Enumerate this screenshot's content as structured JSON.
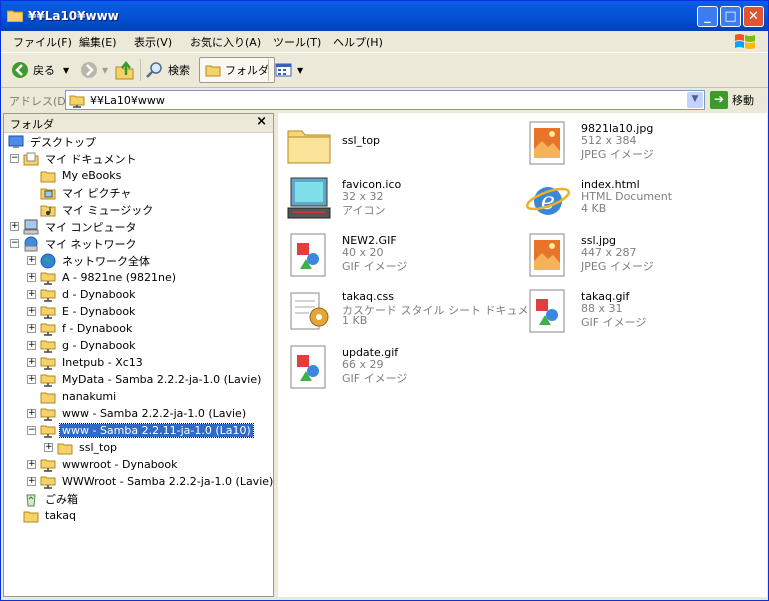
{
  "window": {
    "title": "¥¥La10¥www"
  },
  "menu": [
    "ファイル(F)",
    "編集(E)",
    "表示(V)",
    "お気に入り(A)",
    "ツール(T)",
    "ヘルプ(H)"
  ],
  "toolbar": {
    "back": "戻る",
    "search": "検索",
    "folders": "フォルダ"
  },
  "address": {
    "label": "アドレス(D)",
    "value": "¥¥La10¥www",
    "go": "移動"
  },
  "folder_pane": {
    "title": "フォルダ",
    "close": "×",
    "tree": [
      {
        "label": "デスクトップ",
        "exp": "",
        "icon": "desktop"
      },
      {
        "label": "マイ ドキュメント",
        "exp": "−",
        "icon": "mydocs"
      },
      {
        "label": "My eBooks",
        "exp": "",
        "icon": "folder"
      },
      {
        "label": "マイ ピクチャ",
        "exp": "",
        "icon": "pictures"
      },
      {
        "label": "マイ ミュージック",
        "exp": "",
        "icon": "music"
      },
      {
        "label": "マイ コンピュータ",
        "exp": "+",
        "icon": "computer"
      },
      {
        "label": "マイ ネットワーク",
        "exp": "−",
        "icon": "network"
      },
      {
        "label": "ネットワーク全体",
        "exp": "+",
        "icon": "globe"
      },
      {
        "label": "A - 9821ne (9821ne)",
        "exp": "+",
        "icon": "share"
      },
      {
        "label": "d - Dynabook",
        "exp": "+",
        "icon": "share"
      },
      {
        "label": "E - Dynabook",
        "exp": "+",
        "icon": "share"
      },
      {
        "label": "f - Dynabook",
        "exp": "+",
        "icon": "share"
      },
      {
        "label": "g - Dynabook",
        "exp": "+",
        "icon": "share"
      },
      {
        "label": "Inetpub - Xc13",
        "exp": "+",
        "icon": "share"
      },
      {
        "label": "MyData - Samba 2.2.2-ja-1.0 (Lavie)",
        "exp": "+",
        "icon": "share"
      },
      {
        "label": "nanakumi",
        "exp": "",
        "icon": "folder"
      },
      {
        "label": "www - Samba 2.2.2-ja-1.0 (Lavie)",
        "exp": "+",
        "icon": "share"
      },
      {
        "label": "www - Samba 2.2.11-ja-1.0 (La10)",
        "exp": "−",
        "icon": "share",
        "selected": true
      },
      {
        "label": "ssl_top",
        "exp": "+",
        "icon": "folder"
      },
      {
        "label": "wwwroot - Dynabook",
        "exp": "+",
        "icon": "share"
      },
      {
        "label": "WWWroot - Samba 2.2.2-ja-1.0 (Lavie)",
        "exp": "+",
        "icon": "share"
      },
      {
        "label": "ごみ箱",
        "exp": "",
        "icon": "recycle"
      },
      {
        "label": "takaq",
        "exp": "",
        "icon": "folder"
      }
    ]
  },
  "files": [
    {
      "name": "ssl_top",
      "line2": "",
      "line3": "",
      "icon": "folder"
    },
    {
      "name": "9821la10.jpg",
      "line2": "512 x 384",
      "line3": "JPEG イメージ",
      "icon": "jpeg"
    },
    {
      "name": "favicon.ico",
      "line2": "32 x 32",
      "line3": "アイコン",
      "icon": "computer-ico"
    },
    {
      "name": "index.html",
      "line2": "HTML Document",
      "line3": "4 KB",
      "icon": "ie"
    },
    {
      "name": "NEW2.GIF",
      "line2": "40 x 20",
      "line3": "GIF イメージ",
      "icon": "gif"
    },
    {
      "name": "ssl.jpg",
      "line2": "447 x 287",
      "line3": "JPEG イメージ",
      "icon": "jpeg"
    },
    {
      "name": "takaq.css",
      "line2": "カスケード スタイル シート ドキュメント",
      "line3": "1 KB",
      "icon": "css"
    },
    {
      "name": "takaq.gif",
      "line2": "88 x 31",
      "line3": "GIF イメージ",
      "icon": "gif"
    },
    {
      "name": "update.gif",
      "line2": "66 x 29",
      "line3": "GIF イメージ",
      "icon": "gif"
    }
  ]
}
